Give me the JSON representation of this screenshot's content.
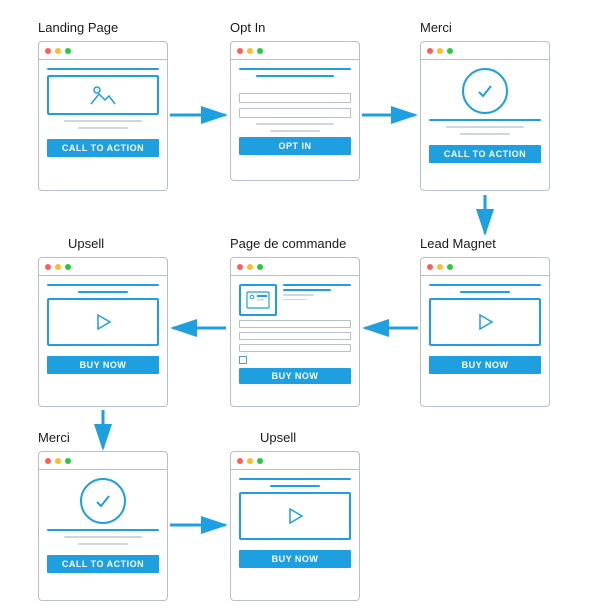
{
  "colors": {
    "accent": "#1d9fe0",
    "border": "#b8c0c7",
    "grey": "#cfd6dc"
  },
  "pages": {
    "landing": {
      "title": "Landing Page",
      "cta": "CALL TO ACTION"
    },
    "optin": {
      "title": "Opt In",
      "cta": "OPT IN"
    },
    "merci1": {
      "title": "Merci",
      "cta": "CALL TO ACTION"
    },
    "leadmagnet": {
      "title": "Lead Magnet",
      "cta": "BUY NOW"
    },
    "order": {
      "title": "Page de commande",
      "cta": "BUY NOW"
    },
    "upsell1": {
      "title": "Upsell",
      "cta": "BUY NOW"
    },
    "merci2": {
      "title": "Merci",
      "cta": "CALL TO ACTION"
    },
    "upsell2": {
      "title": "Upsell",
      "cta": "BUY NOW"
    }
  }
}
